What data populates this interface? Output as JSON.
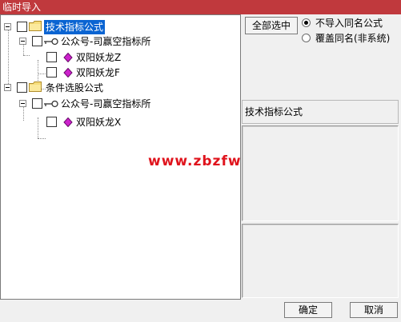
{
  "window": {
    "title": "临时导入"
  },
  "tree": {
    "groups": [
      {
        "label": "技术指标公式",
        "children": [
          {
            "label": "公众号-司赢空指标所",
            "items": [
              "双阳妖龙Z",
              "双阳妖龙F"
            ]
          }
        ]
      },
      {
        "label": "条件选股公式",
        "children": [
          {
            "label": "公众号-司赢空指标所",
            "items": [
              "双阳妖龙X"
            ]
          }
        ]
      }
    ]
  },
  "watermark": "www.zbzfwu.com",
  "options": {
    "select_all_label": "全部选中",
    "radios": [
      {
        "label": "不导入同名公式",
        "checked": true
      },
      {
        "label": "覆盖同名(非系统)",
        "checked": false
      }
    ]
  },
  "detail": {
    "formula_type": "技术指标公式"
  },
  "footer": {
    "ok_label": "确定",
    "cancel_label": "取消"
  },
  "colors": {
    "titlebar": "#c0393d",
    "selection": "#0a64d2",
    "watermark": "#e0141d"
  }
}
